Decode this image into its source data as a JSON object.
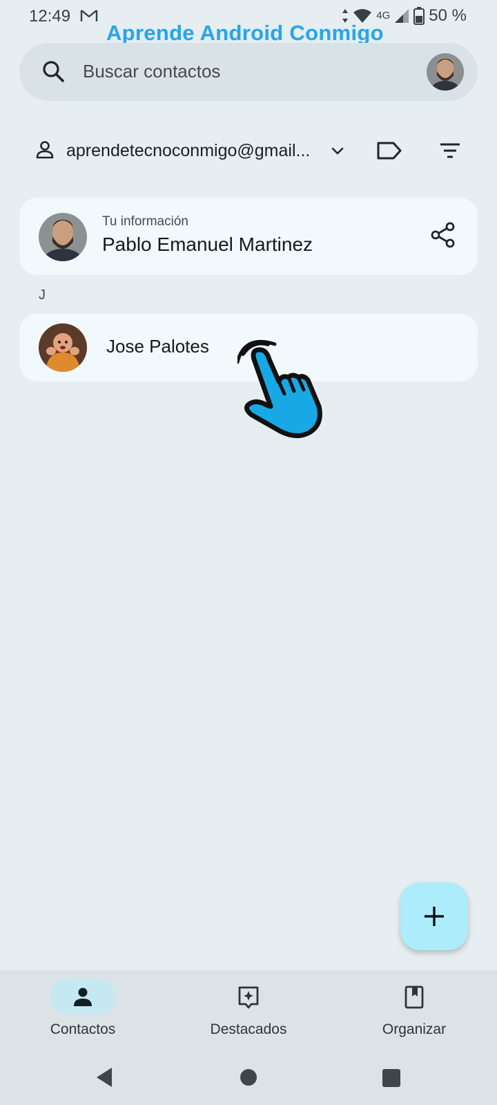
{
  "status_bar": {
    "time": "12:49",
    "network": "4G",
    "battery": "50 %"
  },
  "watermark": "Aprende Android Conmigo",
  "search": {
    "placeholder": "Buscar contactos"
  },
  "account": {
    "email": "aprendetecnoconmigo@gmail..."
  },
  "my_info": {
    "caption": "Tu información",
    "name": "Pablo Emanuel Martinez"
  },
  "sections": [
    {
      "letter": "J",
      "contacts": [
        {
          "name": "Jose Palotes"
        }
      ]
    }
  ],
  "bottom_nav": {
    "items": [
      {
        "label": "Contactos",
        "icon": "person-icon",
        "active": true
      },
      {
        "label": "Destacados",
        "icon": "star-sparkle-icon",
        "active": false
      },
      {
        "label": "Organizar",
        "icon": "bookmark-icon",
        "active": false
      }
    ]
  },
  "colors": {
    "background": "#e6eef2",
    "card": "#f2f9fc",
    "fab": "#acecfb",
    "watermark": "#2aa5e6",
    "active_nav_pill": "#c6e8f1"
  }
}
